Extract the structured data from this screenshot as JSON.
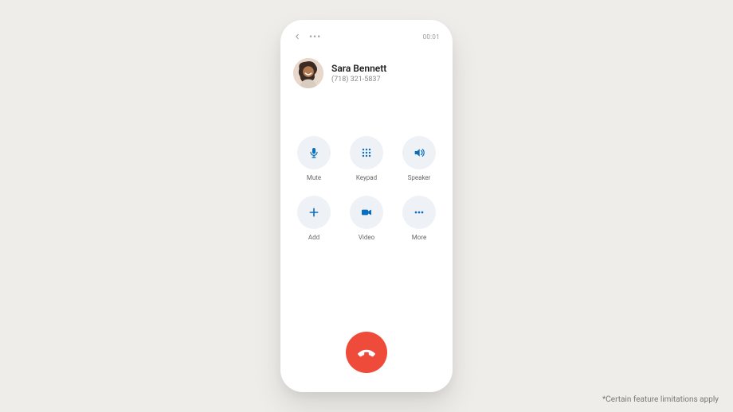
{
  "colors": {
    "background": "#efedea",
    "phone_bg": "#ffffff",
    "icon_accent": "#0a6ebd",
    "action_circle": "#eef2f6",
    "end_call": "#ef4b3a",
    "text_primary": "#222222",
    "text_secondary": "#888888"
  },
  "topbar": {
    "back_icon": "back-chevron",
    "more_icon": "more-horizontal",
    "timer": "00:01"
  },
  "caller": {
    "name": "Sara Bennett",
    "phone": "(718) 321-5837",
    "avatar": "avatar-photo"
  },
  "actions": [
    {
      "id": "mute",
      "label": "Mute",
      "icon": "mic-icon"
    },
    {
      "id": "keypad",
      "label": "Keypad",
      "icon": "keypad-icon"
    },
    {
      "id": "speaker",
      "label": "Speaker",
      "icon": "speaker-icon"
    },
    {
      "id": "add",
      "label": "Add",
      "icon": "plus-icon"
    },
    {
      "id": "video",
      "label": "Video",
      "icon": "video-icon"
    },
    {
      "id": "more",
      "label": "More",
      "icon": "more-icon"
    }
  ],
  "end_call": {
    "icon": "phone-hangup-icon"
  },
  "footnote": "*Certain feature limitations apply"
}
